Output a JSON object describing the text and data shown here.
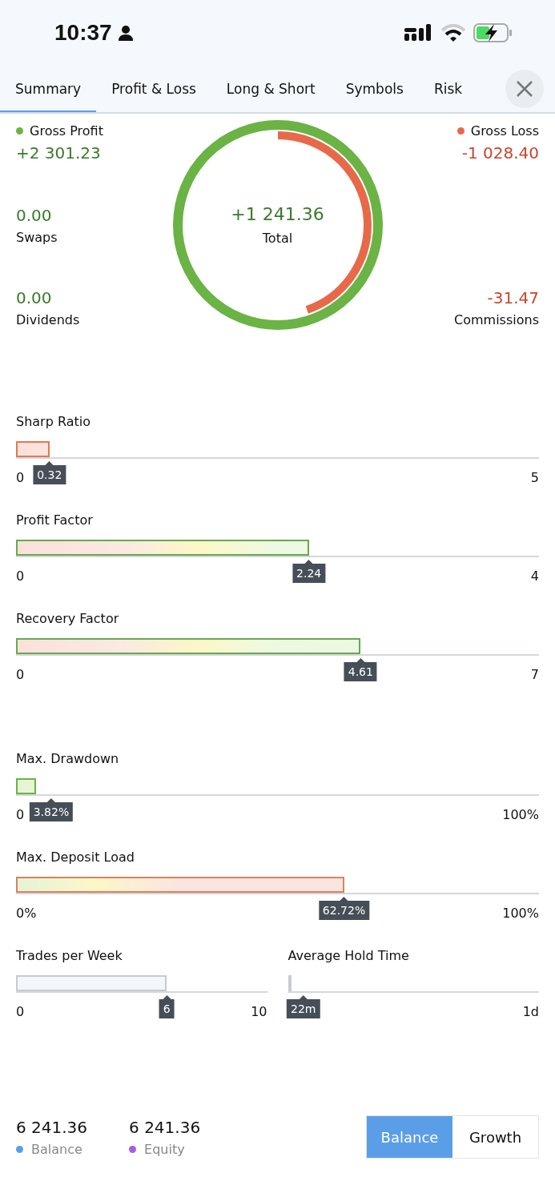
{
  "status_bar": {
    "time": "10:37"
  },
  "tabs": [
    {
      "label": "Summary",
      "selected": true
    },
    {
      "label": "Profit & Loss",
      "selected": false
    },
    {
      "label": "Long & Short",
      "selected": false
    },
    {
      "label": "Symbols",
      "selected": false
    },
    {
      "label": "Risk",
      "selected": false
    }
  ],
  "summary": {
    "gross_profit": {
      "label": "Gross Profit",
      "value": "+2 301.23"
    },
    "gross_loss": {
      "label": "Gross Loss",
      "value": "-1 028.40"
    },
    "swaps": {
      "label": "Swaps",
      "value": "0.00"
    },
    "dividends": {
      "label": "Dividends",
      "value": "0.00"
    },
    "commissions": {
      "label": "Commissions",
      "value": "-31.47"
    },
    "total": {
      "label": "Total",
      "value": "+1 241.36"
    },
    "ring": {
      "level": 0.447
    }
  },
  "ratios": [
    {
      "label": "Sharp Ratio",
      "min": "0",
      "max": "5",
      "value": "0.32",
      "level": 0.064,
      "kind": "rising"
    },
    {
      "label": "Profit Factor",
      "min": "0",
      "max": "4",
      "value": "2.24",
      "level": 0.56,
      "kind": "rising"
    },
    {
      "label": "Recovery Factor",
      "min": "0",
      "max": "7",
      "value": "4.61",
      "level": 0.659,
      "kind": "rising"
    }
  ],
  "risk_metrics": [
    {
      "label": "Max. Drawdown",
      "min": "0",
      "max": "100%",
      "value": "3.82%",
      "level": 0.0382,
      "kind": "falling"
    },
    {
      "label": "Max. Deposit Load",
      "min": "0%",
      "max": "100%",
      "value": "62.72%",
      "level": 0.6272,
      "kind": "falling"
    }
  ],
  "activity_metrics": [
    {
      "label": "Trades per Week",
      "min": "0",
      "max": "10",
      "value": "6",
      "level": 0.6,
      "kind": "plain"
    },
    {
      "label": "Average Hold Time",
      "max": "1d",
      "value": "22m",
      "level": 0.015,
      "kind": "plain"
    }
  ],
  "totals": [
    {
      "value": "6 241.36",
      "label": "Balance",
      "color": "#5b9ee8"
    },
    {
      "value": "6 241.36",
      "label": "Equity",
      "color": "#a45ee8"
    }
  ],
  "chart_mode": [
    {
      "label": "Balance",
      "selected": true
    },
    {
      "label": "Growth",
      "selected": false
    }
  ]
}
